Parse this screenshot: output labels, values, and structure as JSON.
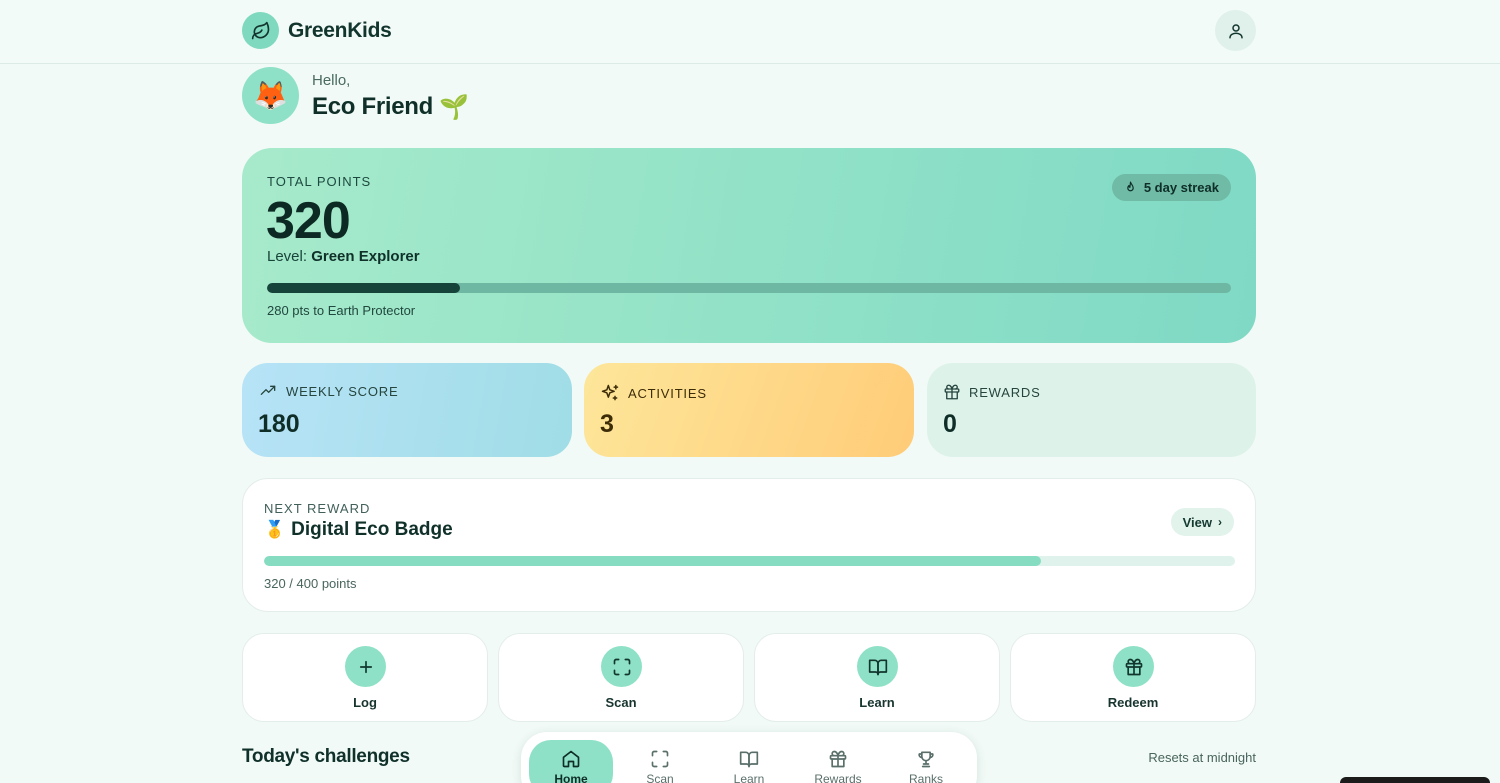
{
  "app": {
    "name": "GreenKids"
  },
  "greeting": {
    "hello": "Hello,",
    "name": "Eco Friend",
    "avatar": "🦊",
    "sprout": "🌱"
  },
  "points": {
    "label": "TOTAL POINTS",
    "value": "320",
    "level_prefix": "Level: ",
    "level": "Green Explorer",
    "streak": "5 day streak",
    "progress": 0.2,
    "footnote": "280 pts to Earth Protector"
  },
  "stats": [
    {
      "label": "WEEKLY SCORE",
      "value": "180",
      "icon": "trending-up-icon"
    },
    {
      "label": "ACTIVITIES",
      "value": "3",
      "icon": "sparkles-icon"
    },
    {
      "label": "REWARDS",
      "value": "0",
      "icon": "gift-icon"
    }
  ],
  "next_reward": {
    "label": "NEXT REWARD",
    "medal": "🥇",
    "title": "Digital Eco Badge",
    "view_label": "View",
    "progress": 0.8,
    "footnote": "320 / 400 points"
  },
  "actions": [
    {
      "label": "Log",
      "icon": "plus-icon"
    },
    {
      "label": "Scan",
      "icon": "scan-icon"
    },
    {
      "label": "Learn",
      "icon": "book-icon"
    },
    {
      "label": "Redeem",
      "icon": "gift-icon"
    }
  ],
  "challenges": {
    "title": "Today's challenges",
    "resets": "Resets at midnight"
  },
  "nav": [
    {
      "label": "Home",
      "icon": "home-icon",
      "active": true
    },
    {
      "label": "Scan",
      "icon": "scan-icon"
    },
    {
      "label": "Learn",
      "icon": "book-icon"
    },
    {
      "label": "Rewards",
      "icon": "gift-icon"
    },
    {
      "label": "Ranks",
      "icon": "trophy-icon"
    }
  ],
  "colors": {
    "accent": "#8ee1c6",
    "dark": "#16433a",
    "background": "#f1faf6"
  }
}
